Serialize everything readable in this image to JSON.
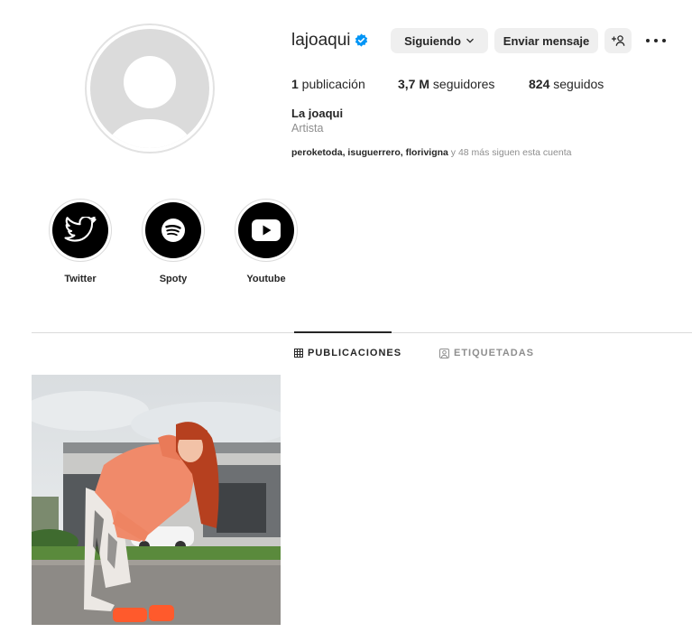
{
  "profile": {
    "username": "lajoaqui",
    "full_name": "La joaqui",
    "category": "Artista",
    "verified": true
  },
  "actions": {
    "follow_label": "Siguiendo",
    "message_label": "Enviar mensaje",
    "suggest_label": "+ዶ"
  },
  "stats": {
    "posts_count": "1",
    "posts_label": " publicación",
    "followers_count": "3,7 M",
    "followers_label": " seguidores",
    "following_count": "824",
    "following_label": " seguidos"
  },
  "followed_by": {
    "names": "peroketoda, isuguerrero, florivigna",
    "rest": " y 48 más siguen esta cuenta"
  },
  "highlights": [
    {
      "label": "Twitter",
      "icon": "twitter-icon"
    },
    {
      "label": "Spoty",
      "icon": "spotify-icon"
    },
    {
      "label": "Youtube",
      "icon": "youtube-icon"
    }
  ],
  "tabs": [
    {
      "label": "PUBLICACIONES",
      "icon": "grid-icon",
      "active": true
    },
    {
      "label": "ETIQUETADAS",
      "icon": "tagged-icon",
      "active": false
    }
  ],
  "colors": {
    "verified_blue": "#0095f6",
    "button_bg": "#efefef",
    "muted_text": "#8e8e8e",
    "divider": "#dbdbdb"
  }
}
